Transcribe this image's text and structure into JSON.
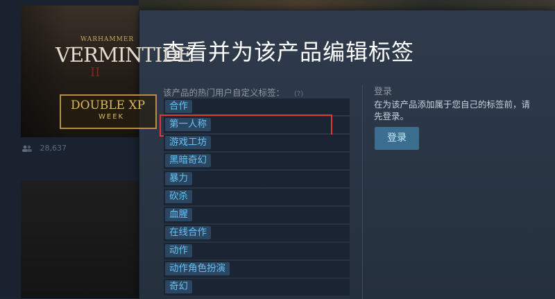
{
  "background": {
    "game_logo_small": "WARHAMMER",
    "game_logo_big": "VERMINTIDE",
    "game_logo_num": "II",
    "promo_title": "DOUBLE XP",
    "promo_sub": "WEEK",
    "player_count": "28,637",
    "icons": {
      "players": "users-icon"
    }
  },
  "modal": {
    "title": "查看并为该产品编辑标签",
    "tags_header": "该产品的热门用户自定义标签：",
    "help_label": "(?)",
    "tags": [
      "合作",
      "第一人称",
      "游戏工坊",
      "黑暗奇幻",
      "暴力",
      "砍杀",
      "血腥",
      "在线合作",
      "动作",
      "动作角色扮演",
      "奇幻"
    ],
    "highlighted_tag": "第一人称",
    "highlight_color": "#e0383a",
    "login": {
      "title": "登录",
      "desc_line1": "在为该产品添加属于您自己的标签前，请",
      "desc_line2": "先登录。",
      "button": "登录"
    }
  },
  "colors": {
    "modal_bg": "#2f3b4c",
    "tag_text": "#67c1f5",
    "tag_chip_bg": "#2b4660",
    "button_bg": "#3b6e8f"
  }
}
